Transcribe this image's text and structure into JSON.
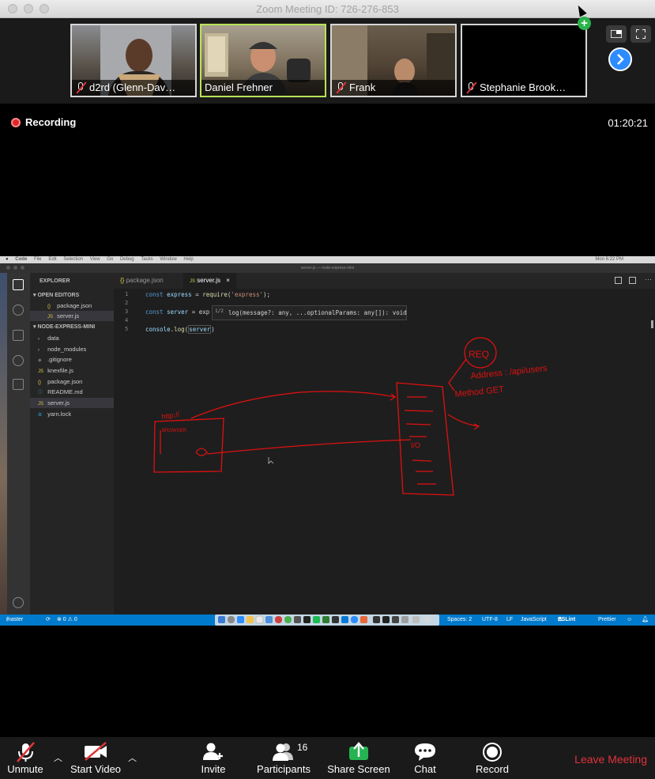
{
  "window": {
    "title": "Zoom Meeting ID: 726-276-853"
  },
  "participants_strip": [
    {
      "name": "d2rd (Glenn-Dav…",
      "muted": true,
      "active": false
    },
    {
      "name": "Daniel Frehner",
      "muted": false,
      "active": true
    },
    {
      "name": "Frank",
      "muted": true,
      "active": false
    },
    {
      "name": "Stephanie Brook…",
      "muted": true,
      "active": false
    }
  ],
  "recording": {
    "label": "Recording",
    "elapsed": "01:20:21"
  },
  "screen_share": {
    "mac_menu": [
      "Code",
      "File",
      "Edit",
      "Selection",
      "View",
      "Go",
      "Debug",
      "Tasks",
      "Window",
      "Help"
    ],
    "mac_clock": "Mon 6:22 PM",
    "vscode_title": "server.js — node-express-mini",
    "explorer": {
      "header": "EXPLORER",
      "open_editors_label": "OPEN EDITORS",
      "open_editors": [
        "package.json",
        "server.js"
      ],
      "project_label": "NODE-EXPRESS-MINI",
      "files": [
        "data",
        "node_modules",
        ".gitignore",
        "knexfile.js",
        "package.json",
        "README.md",
        "server.js",
        "yarn.lock"
      ]
    },
    "tabs": [
      "package.json",
      "server.js"
    ],
    "tab_close": "×",
    "line_numbers": [
      "1",
      "2",
      "3",
      "4",
      "5"
    ],
    "code": {
      "line1_kw": "const",
      "line1_var": "express",
      "line1_eq": " = ",
      "line1_fn": "require",
      "line1_str": "'express'",
      "line1_end": ");",
      "line3_kw": "const",
      "line3_var": "server",
      "line3_rest": " = exp",
      "line5_obj": "console",
      "line5_fn": ".log(",
      "line5_arg": "server",
      "line5_end": ")"
    },
    "hover": {
      "counter": "1/2",
      "signature": "log(message?: any, ...optionalParams: any[]): void"
    },
    "status": {
      "branch": "master",
      "errors": "⊗ 0 ⚠ 0",
      "spaces": "Spaces: 2",
      "encoding": "UTF-8",
      "eol": "LF",
      "language": "JavaScript",
      "lint": "ESLint",
      "formatter": "Prettier"
    },
    "whiteboard": {
      "browser": "BROWSER",
      "http": "http://",
      "req": "REQ",
      "address": "Address : /api/users",
      "method": "Method GET",
      "io": "I/O"
    }
  },
  "toolbar": {
    "unmute": "Unmute",
    "start_video": "Start Video",
    "invite": "Invite",
    "participants": "Participants",
    "participants_count": "16",
    "share_screen": "Share Screen",
    "chat": "Chat",
    "record": "Record",
    "leave": "Leave Meeting"
  },
  "colors": {
    "accent_blue": "#2d8cff",
    "leave_red": "#e0333b",
    "active_speaker": "#b8e356",
    "share_green": "#26b352"
  }
}
